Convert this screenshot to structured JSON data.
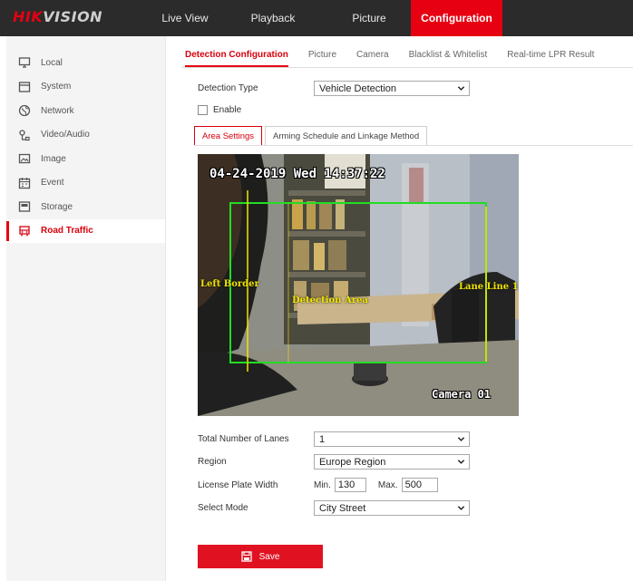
{
  "brand": {
    "logo_red": "HIK",
    "logo_rest": "VISION"
  },
  "top_nav": {
    "items": [
      {
        "label": "Live View"
      },
      {
        "label": "Playback"
      },
      {
        "label": "Picture"
      },
      {
        "label": "Configuration",
        "active": true
      }
    ]
  },
  "sidebar": {
    "items": [
      {
        "label": "Local",
        "icon": "monitor-icon"
      },
      {
        "label": "System",
        "icon": "system-icon"
      },
      {
        "label": "Network",
        "icon": "globe-icon"
      },
      {
        "label": "Video/Audio",
        "icon": "video-audio-icon"
      },
      {
        "label": "Image",
        "icon": "image-icon"
      },
      {
        "label": "Event",
        "icon": "calendar-icon"
      },
      {
        "label": "Storage",
        "icon": "storage-icon"
      },
      {
        "label": "Road Traffic",
        "icon": "vehicle-icon",
        "active": true
      }
    ]
  },
  "sub_tabs": [
    {
      "label": "Detection Configuration",
      "active": true
    },
    {
      "label": "Picture"
    },
    {
      "label": "Camera"
    },
    {
      "label": "Blacklist & Whitelist"
    },
    {
      "label": "Real-time LPR Result"
    }
  ],
  "detection_type": {
    "label": "Detection Type",
    "value": "Vehicle Detection"
  },
  "enable": {
    "label": "Enable",
    "checked": false
  },
  "area_tabs": [
    {
      "label": "Area Settings",
      "active": true
    },
    {
      "label": "Arming Schedule and Linkage Method"
    }
  ],
  "video": {
    "timestamp": "04-24-2019 Wed 14:37:22",
    "camera_name": "Camera 01",
    "overlays": {
      "left_border": "Left Border",
      "detection_area": "Detection Area",
      "lane_line": "Lane Line 1"
    },
    "colors": {
      "detection_box": "#22dd22",
      "lane_lines": "#f1e600"
    }
  },
  "form": {
    "lanes": {
      "label": "Total Number of Lanes",
      "value": "1"
    },
    "region": {
      "label": "Region",
      "value": "Europe Region"
    },
    "plate_width": {
      "label": "License Plate Width",
      "min_label": "Min.",
      "min_value": "130",
      "max_label": "Max.",
      "max_value": "500"
    },
    "select_mode": {
      "label": "Select Mode",
      "value": "City Street"
    }
  },
  "save_button": {
    "label": "Save"
  },
  "colors": {
    "accent": "#e60012",
    "topbar": "#2b2b2b",
    "sidebar": "#f4f4f4"
  }
}
